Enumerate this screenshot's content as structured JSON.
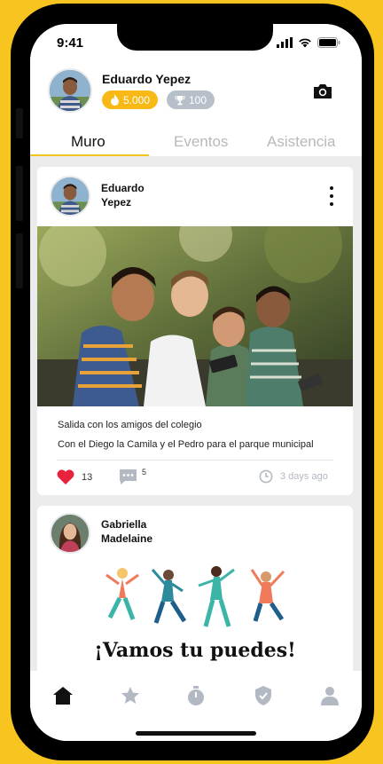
{
  "status_bar": {
    "time": "9:41"
  },
  "profile": {
    "name": "Eduardo Yepez",
    "points": "5.000",
    "trophies": "100"
  },
  "tabs": [
    {
      "label": "Muro",
      "active": true
    },
    {
      "label": "Eventos",
      "active": false
    },
    {
      "label": "Asistencia",
      "active": false
    }
  ],
  "posts": [
    {
      "author_line1": "Eduardo",
      "author_line2": "Yepez",
      "title": "Salida con los amigos del colegio",
      "body": "Con el Diego la Camila y el Pedro para el parque municipal",
      "likes": "13",
      "comments": "5",
      "time": "3 days ago"
    },
    {
      "author_line1": "Gabriella",
      "author_line2": "Madelaine",
      "banner_text": "¡Vamos tu puedes!"
    }
  ],
  "bottom_nav": [
    "home-icon",
    "star-icon",
    "stopwatch-icon",
    "shield-icon",
    "user-icon"
  ],
  "colors": {
    "accent": "#f8c41f",
    "fire_pill": "#f8b916",
    "trophy_pill": "#b7bfc8",
    "heart": "#e8213c",
    "tab_inactive": "#b9b9b9"
  }
}
